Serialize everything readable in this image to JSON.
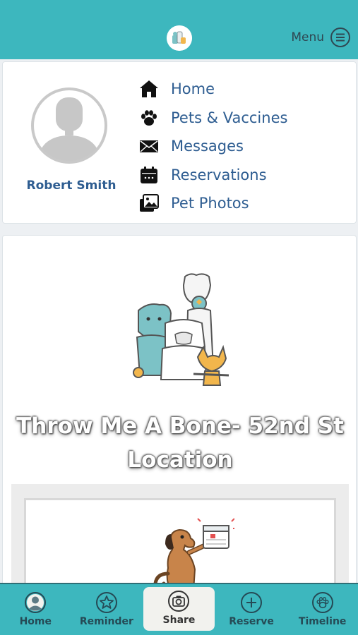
{
  "header": {
    "menu_label": "Menu"
  },
  "profile": {
    "user_name": "Robert Smith"
  },
  "nav": {
    "items": [
      {
        "label": "Home",
        "icon": "home-icon"
      },
      {
        "label": "Pets & Vaccines",
        "icon": "paw-icon"
      },
      {
        "label": "Messages",
        "icon": "envelope-icon"
      },
      {
        "label": "Reservations",
        "icon": "calendar-icon"
      },
      {
        "label": "Pet Photos",
        "icon": "photos-icon"
      }
    ]
  },
  "location": {
    "title": "Throw Me A Bone- 52nd St Location"
  },
  "bottom_nav": {
    "items": [
      {
        "label": "Home",
        "icon": "profile-icon",
        "active": false
      },
      {
        "label": "Reminder",
        "icon": "star-icon",
        "active": false
      },
      {
        "label": "Share",
        "icon": "camera-icon",
        "active": true
      },
      {
        "label": "Reserve",
        "icon": "plus-icon",
        "active": false
      },
      {
        "label": "Timeline",
        "icon": "paw-icon",
        "active": false
      }
    ]
  },
  "colors": {
    "brand_teal": "#3db7be",
    "link_blue": "#2e5d91"
  }
}
